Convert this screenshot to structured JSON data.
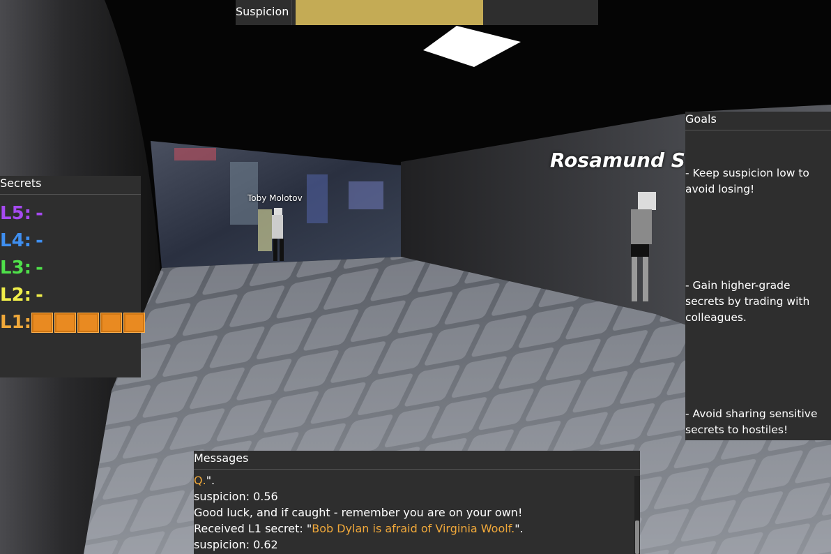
{
  "suspicion": {
    "label": "Suspicion",
    "level": 0.62,
    "fill_color": "#c4ab55"
  },
  "secrets": {
    "title": "Secrets",
    "rows": [
      {
        "label": "L5:",
        "value": "-",
        "color": "#a54af0"
      },
      {
        "label": "L4:",
        "value": "-",
        "color": "#3f8ff0"
      },
      {
        "label": "L3:",
        "value": "-",
        "color": "#4fe04a"
      },
      {
        "label": "L2:",
        "value": "-",
        "color": "#f0ee4a"
      },
      {
        "label": "L1:",
        "value": "",
        "color": "#f0a83a",
        "blocks": 5
      }
    ]
  },
  "goals": {
    "title": "Goals",
    "items": [
      "- Keep suspicion low to avoid losing!",
      "- Gain higher-grade secrets by trading with colleagues.",
      "- Avoid sharing sensitive secrets to hostiles!"
    ]
  },
  "messages": {
    "title": "Messages",
    "line1_accent": "Q.",
    "line1_rest": "\".",
    "line2": "suspicion: 0.56",
    "line3": "Good luck, and if caught - remember you are on your own!",
    "line4_prefix": "Received L1 secret: \"",
    "line4_secret": "Bob Dylan is afraid of Virginia Woolf.",
    "line4_suffix": "\".",
    "line5": "suspicion: 0.62"
  },
  "npcs": {
    "near_name": "Toby Molotov",
    "far_name": "Rosamund Ste"
  }
}
